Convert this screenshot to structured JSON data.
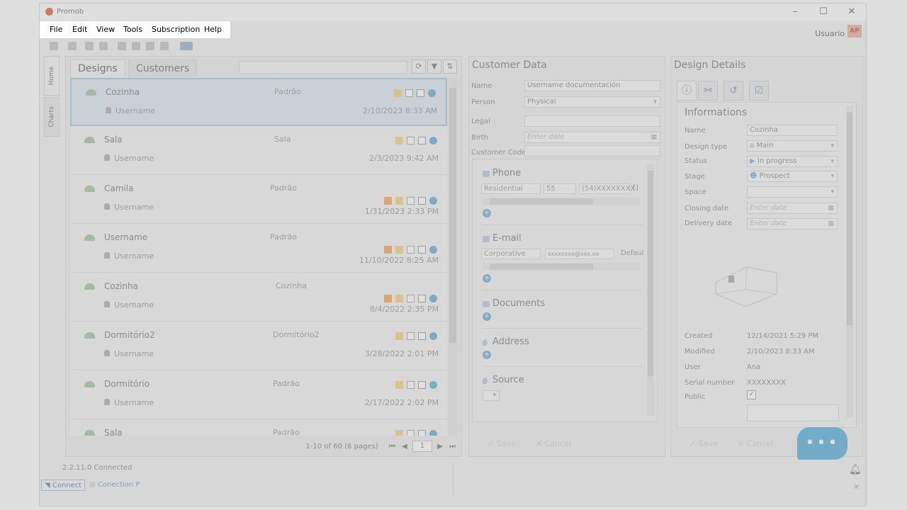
{
  "app": {
    "title": "Promob",
    "user": "Usuario",
    "avatar": "AP",
    "version": "2.2.11.0 Connected"
  },
  "window_controls": {
    "minimize": "–",
    "maximize": "☐",
    "close": "✕"
  },
  "menu": [
    "File",
    "Edit",
    "View",
    "Tools",
    "Subscription",
    "Help"
  ],
  "side_tabs": [
    "Home",
    "Charts"
  ],
  "designs": {
    "tabs": [
      "Designs",
      "Customers"
    ],
    "rows": [
      {
        "name": "Cozinha",
        "user": "Username",
        "category": "Padrão",
        "date": "2/10/2023 8:33 AM",
        "owner_icon": false
      },
      {
        "name": "Sala",
        "user": "Username",
        "category": "Sala",
        "date": "2/3/2023 9:42 AM",
        "owner_icon": false
      },
      {
        "name": "Camila",
        "user": "Username",
        "category": "Padrão",
        "date": "1/31/2023 2:33 PM",
        "owner_icon": true
      },
      {
        "name": "Username",
        "user": "Username",
        "category": "Padrão",
        "date": "11/10/2022 8:25 AM",
        "owner_icon": true
      },
      {
        "name": "Cozinha",
        "user": "Username",
        "category": "Cozinha",
        "date": "8/4/2022 2:35 PM",
        "owner_icon": true
      },
      {
        "name": "Dormitório2",
        "user": "Username",
        "category": "Dormitório2",
        "date": "3/28/2022 2:01 PM",
        "owner_icon": false
      },
      {
        "name": "Dormitório",
        "user": "Username",
        "category": "Padrão",
        "date": "2/17/2022 2:02 PM",
        "owner_icon": false
      },
      {
        "name": "Sala",
        "user": "",
        "category": "Padrão",
        "date": "",
        "owner_icon": false
      }
    ],
    "pager": {
      "summary": "1-10 of 60 (6 pages)",
      "page": "1"
    }
  },
  "customer": {
    "title": "Customer Data",
    "labels": {
      "name": "Name",
      "person": "Person",
      "legal": "Legal",
      "birth": "Birth",
      "code": "Customer Code"
    },
    "name_value": "Username documentación",
    "person_value": "Physical",
    "birth_placeholder": "Enter date",
    "phone": {
      "title": "Phone",
      "type": "Residential",
      "country": "55",
      "number": "(54)XXXXXXXX",
      "extra": "[]"
    },
    "email": {
      "title": "E-mail",
      "type": "Corporative",
      "address": "xxxxxxxx@xxx.xx",
      "default": "Defaul"
    },
    "documents": {
      "title": "Documents"
    },
    "address": {
      "title": "Address"
    },
    "source": {
      "title": "Source"
    },
    "save": "Save",
    "cancel": "Cancel"
  },
  "details": {
    "title": "Design Details",
    "section": "Informations",
    "labels": {
      "name": "Name",
      "design_type": "Design type",
      "status": "Status",
      "stage": "Stage",
      "space": "Space",
      "closing": "Closing date",
      "delivery": "Delivery date",
      "created": "Created",
      "modified": "Modified",
      "user": "User",
      "serial": "Serial number",
      "public": "Public"
    },
    "values": {
      "name": "Cozinha",
      "design_type": "Main",
      "status": "In progress",
      "stage": "Prospect",
      "created": "12/14/2021 5:29 PM",
      "modified": "2/10/2023 8:33 AM",
      "user": "Ana",
      "serial": "XXXXXXXX"
    },
    "date_placeholder": "Enter date",
    "save": "Save",
    "cancel": "Cancel"
  },
  "statusbar": {
    "connect": "Connect",
    "connection": "Conection P"
  },
  "chat": {
    "dots": "•••"
  }
}
